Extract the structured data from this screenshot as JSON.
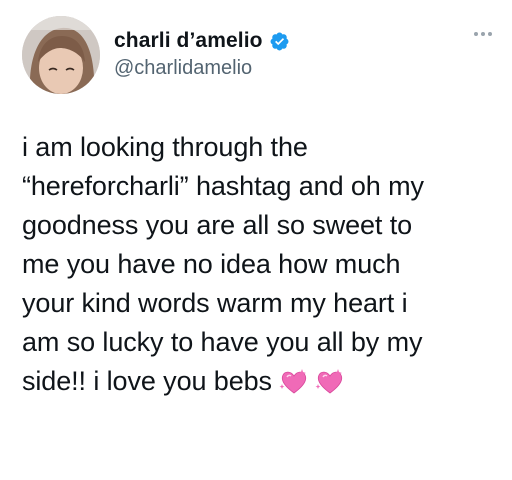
{
  "author": {
    "display_name": "charli d’amelio",
    "handle": "@charlidamelio",
    "verified": true
  },
  "tweet": {
    "lines": [
      "i am looking through the",
      "“hereforcharli” hashtag and oh my",
      "goodness you are all so sweet to",
      "me you have no idea how much",
      "your kind words warm my heart i",
      "am so lucky to have you all by my",
      "side!! i love you bebs"
    ],
    "trailing_emojis": [
      "sparkling-heart-emoji",
      "sparkling-heart-emoji"
    ]
  },
  "icons": {
    "verified": "verified-badge-icon",
    "more": "more-options-icon"
  },
  "colors": {
    "verified_blue": "#1d9bf0",
    "text": "#0f1419",
    "secondary_text": "#536471",
    "heart_pink": "#f06ab7"
  }
}
